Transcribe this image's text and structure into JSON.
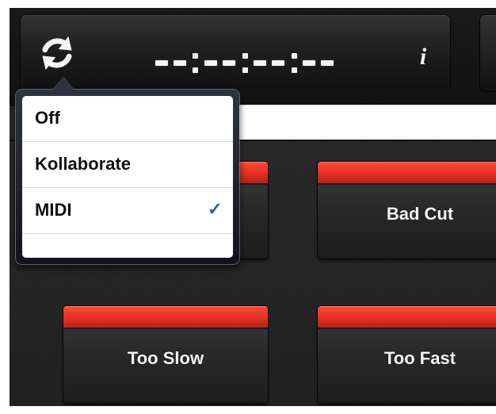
{
  "header": {
    "timecode": "--:--:--:--",
    "info_symbol": "i"
  },
  "sync_menu": {
    "items": [
      {
        "label": "Off",
        "selected": false
      },
      {
        "label": "Kollaborate",
        "selected": false
      },
      {
        "label": "MIDI",
        "selected": true
      }
    ],
    "check_symbol": "✓"
  },
  "cue_buttons": [
    {
      "label": "Bad Cut"
    },
    {
      "label": "Too Slow"
    },
    {
      "label": "Too Fast"
    }
  ],
  "colors": {
    "accent_red": "#e53324",
    "selected_check": "#2f5aa6",
    "background": "#242424"
  }
}
